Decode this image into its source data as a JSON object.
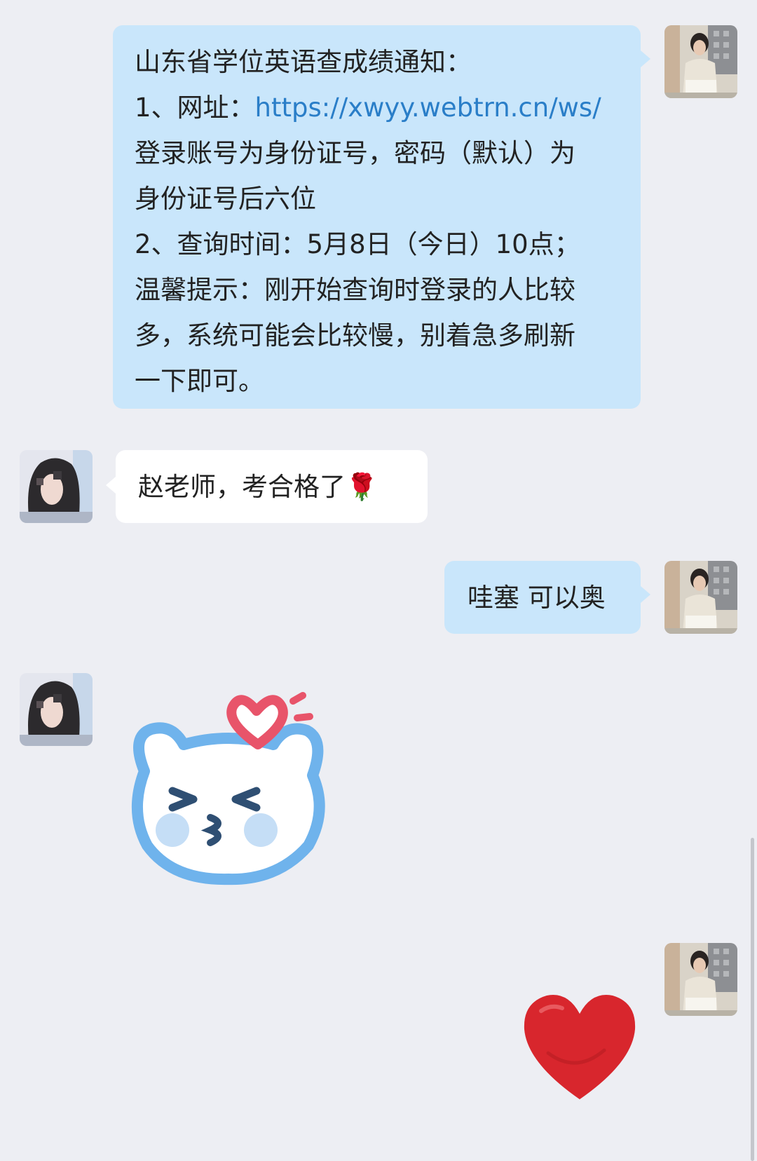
{
  "messages": {
    "notice": {
      "line1": "山东省学位英语查成绩通知：",
      "line2_prefix": "1、网址：",
      "line2_link": "https://xwyy.webtrn.cn/ws/",
      "line3": "登录账号为身份证号，密码（默认）为",
      "line4": "身份证号后六位",
      "line5": "2、查询时间：5月8日（今日）10点；",
      "line6": "温馨提示：刚开始查询时登录的人比较",
      "line7": "多，系统可能会比较慢，别着急多刷新",
      "line8": "一下即可。"
    },
    "reply1": "赵老师，考合格了🌹",
    "reply2": "哇塞 可以奥",
    "sticker_bear": "kissing-bear-sticker",
    "sticker_heart": "red-heart-sticker"
  },
  "colors": {
    "background": "#edeef3",
    "my_bubble": "#c9e6fb",
    "their_bubble": "#ffffff",
    "link": "#2a7ec8",
    "bear_outline": "#6fb3ec",
    "heart": "#d8262d"
  }
}
